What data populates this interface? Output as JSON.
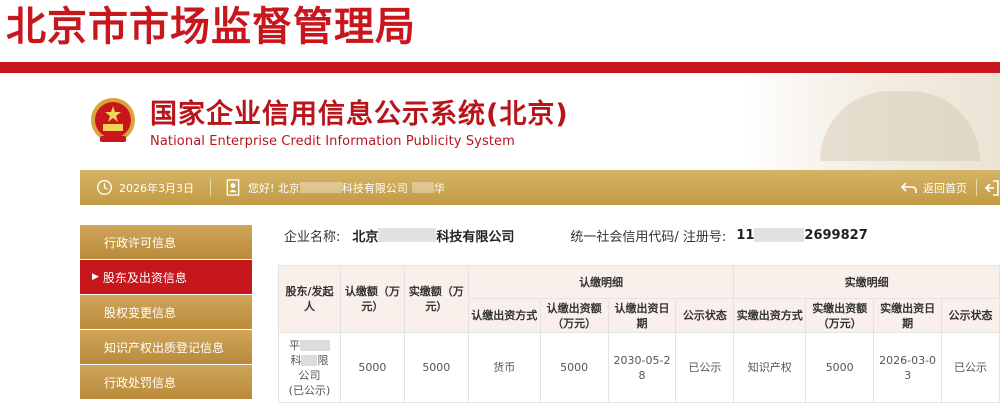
{
  "banner": {
    "title": "北京市市场监督管理局"
  },
  "system": {
    "title_cn": "国家企业信用信息公示系统(北京)",
    "title_en": "National Enterprise Credit Information Publicity System"
  },
  "toolbar": {
    "date": "2026年3月3日",
    "greeting_prefix": "您好! 北京",
    "greeting_mid": "科技有限公司",
    "greeting_suffix": "华",
    "home_link": "返回首页"
  },
  "sidebar": {
    "items": [
      {
        "label": "行政许可信息",
        "active": false
      },
      {
        "label": "股东及出资信息",
        "active": true
      },
      {
        "label": "股权变更信息",
        "active": false
      },
      {
        "label": "知识产权出质登记信息",
        "active": false
      },
      {
        "label": "行政处罚信息",
        "active": false
      }
    ]
  },
  "company": {
    "name_label": "企业名称:",
    "name_prefix": "北京",
    "name_suffix": "科技有限公司",
    "code_label": "统一社会信用代码/ 注册号:",
    "code_prefix": "11",
    "code_suffix": "2699827"
  },
  "table": {
    "headers": {
      "shareholder": "股东/发起人",
      "subscribed_amount": "认缴额（万元）",
      "paid_amount": "实缴额（万元）",
      "subscribed_detail": "认缴明细",
      "paid_detail": "实缴明细",
      "sub_method": "认缴出资方式",
      "sub_amount": "认缴出资额（万元）",
      "sub_date": "认缴出资日期",
      "sub_status": "公示状态",
      "paid_method": "实缴出资方式",
      "paid_amount_detail": "实缴出资额（万元）",
      "paid_date": "实缴出资日期",
      "paid_status": "公示状态"
    },
    "rows": [
      {
        "shareholder_a": "平",
        "shareholder_b": "科",
        "shareholder_c": "限",
        "shareholder_d": "公司",
        "shareholder_e": "(已公示)",
        "subscribed_amount": "5000",
        "paid_amount": "5000",
        "sub_method": "货币",
        "sub_amount": "5000",
        "sub_date": "2030-05-28",
        "sub_status": "已公示",
        "paid_method": "知识产权",
        "paid_amount_detail": "5000",
        "paid_date": "2026-03-03",
        "paid_status": "已公示"
      }
    ]
  },
  "colors": {
    "brand_red": "#c8161d",
    "gold": "#c29a45",
    "table_header_bg": "#faf0eb"
  },
  "icons": {
    "emblem": "national-emblem-icon",
    "clock": "clock-icon",
    "user": "user-badge-icon",
    "home": "return-arrow-icon",
    "logout": "logout-icon"
  }
}
